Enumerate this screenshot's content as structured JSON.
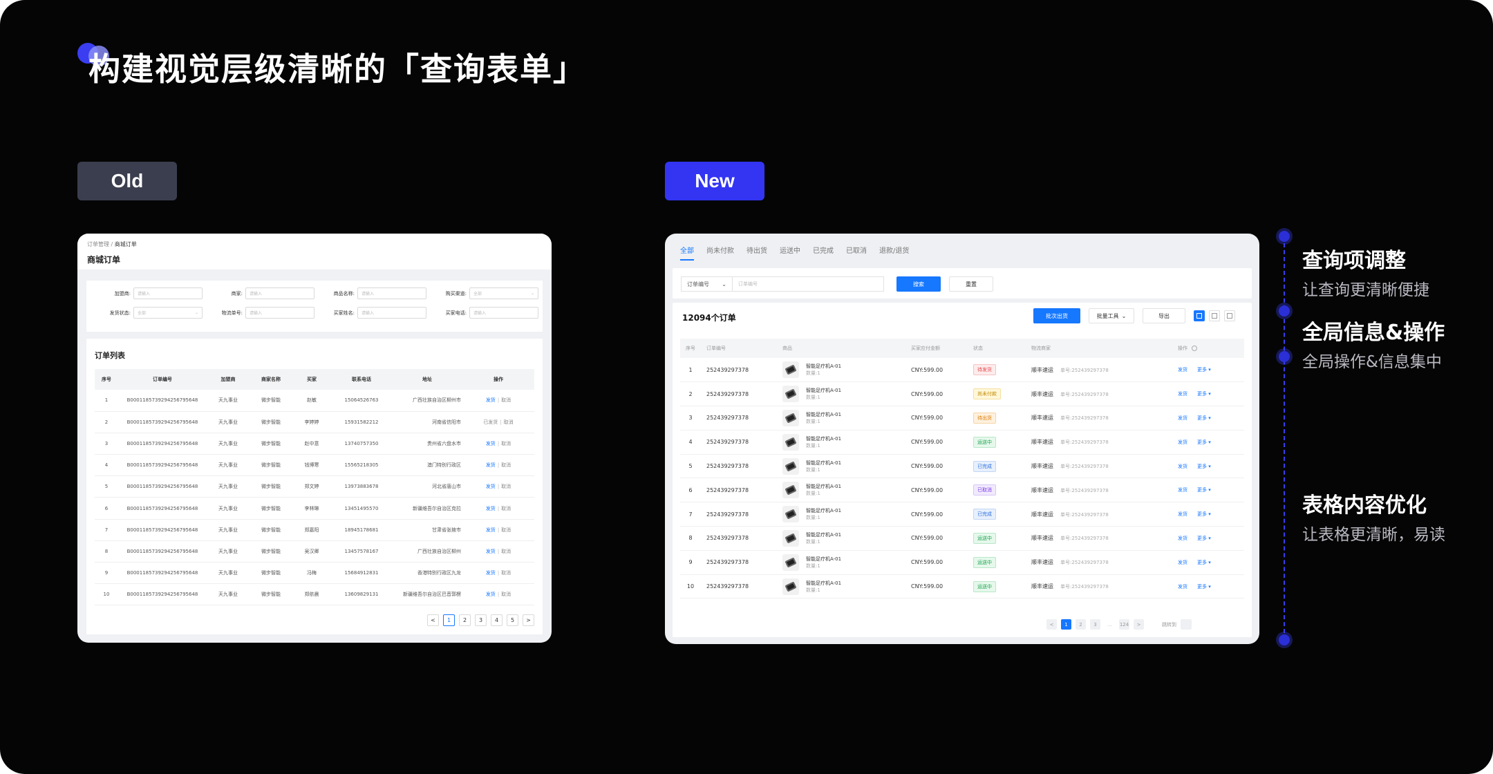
{
  "page": {
    "title": "构建视觉层级清晰的「查询表单」"
  },
  "badges": {
    "old": "Old",
    "new": "New"
  },
  "old": {
    "breadcrumb": {
      "root": "订单管理",
      "sep": "/",
      "current": "商城订单"
    },
    "heading": "商城订单",
    "form": [
      {
        "label": "加盟商:",
        "placeholder": "请输入"
      },
      {
        "label": "商家:",
        "placeholder": "请输入"
      },
      {
        "label": "商品名称:",
        "placeholder": "请输入"
      },
      {
        "label": "购买渠道:",
        "placeholder": "全部"
      },
      {
        "label": "发货状态:",
        "placeholder": "全部"
      },
      {
        "label": "物流单号:",
        "placeholder": "请输入"
      },
      {
        "label": "买家姓名:",
        "placeholder": "请输入"
      },
      {
        "label": "买家电话:",
        "placeholder": "请输入"
      }
    ],
    "list_title": "订单列表",
    "columns": [
      "序号",
      "订单编号",
      "加盟商",
      "商家名称",
      "买家",
      "联系电话",
      "地址",
      "操作"
    ],
    "rows": [
      [
        "1",
        "B0001185739294256795648",
        "天九事业",
        "微步智能",
        "赵敏",
        "15064526763",
        "广西壮族自治区柳州市",
        "发货",
        "取消"
      ],
      [
        "2",
        "B0001185739294256795648",
        "天九事业",
        "微步智能",
        "李婷婷",
        "15931582212",
        "河南省信阳市",
        "已发货",
        "取消"
      ],
      [
        "3",
        "B0001185739294256795648",
        "天九事业",
        "微步智能",
        "赵中意",
        "13740757350",
        "贵州省六盘水市",
        "发货",
        "取消"
      ],
      [
        "4",
        "B0001185739294256795648",
        "天九事业",
        "微步智能",
        "钱博寒",
        "15565218305",
        "澳门特别行政区",
        "发货",
        "取消"
      ],
      [
        "5",
        "B0001185739294256795648",
        "天九事业",
        "微步智能",
        "郑文婷",
        "13973883678",
        "河北省唐山市",
        "发货",
        "取消"
      ],
      [
        "6",
        "B0001185739294256795648",
        "天九事业",
        "微步智能",
        "李林琳",
        "13451495570",
        "新疆维吾尔自治区克拉",
        "发货",
        "取消"
      ],
      [
        "7",
        "B0001185739294256795648",
        "天九事业",
        "微步智能",
        "郑嘉阳",
        "18945178681",
        "甘肃省张掖市",
        "发货",
        "取消"
      ],
      [
        "8",
        "B0001185739294256795648",
        "天九事业",
        "微步智能",
        "吴汉卿",
        "13457578167",
        "广西壮族自治区柳州",
        "发货",
        "取消"
      ],
      [
        "9",
        "B0001185739294256795648",
        "天九事业",
        "微步智能",
        "冯梅",
        "15684912831",
        "香港特别行政区九龙",
        "发货",
        "取消"
      ],
      [
        "10",
        "B0001185739294256795648",
        "天九事业",
        "微步智能",
        "郑依晨",
        "13609829131",
        "新疆维吾尔自治区巴音郭楞",
        "发货",
        "取消"
      ]
    ],
    "pager": {
      "prev": "<",
      "pages": [
        "1",
        "2",
        "3",
        "4",
        "5"
      ],
      "next": ">",
      "current": "1"
    }
  },
  "new": {
    "tabs": [
      "全部",
      "尚未付款",
      "待出货",
      "运送中",
      "已完成",
      "已取消",
      "退款/退货"
    ],
    "active_tab": "全部",
    "search": {
      "select": "订单编号",
      "placeholder": "订单编号",
      "search": "搜索",
      "reset": "重置"
    },
    "count": "12094个订单",
    "toolbar": {
      "batch_ship": "批次出货",
      "batch_tools": "批量工具",
      "export": "导出"
    },
    "columns": [
      "序号",
      "订单编号",
      "商品",
      "买家应付金额",
      "状态",
      "物流商家",
      "操作"
    ],
    "product": {
      "name": "智能足疗机A-01",
      "qty": "数量:1"
    },
    "rows": [
      {
        "idx": "1",
        "order": "252439297378",
        "amount": "CNY:599.00",
        "status": "待发货",
        "tone": "t1",
        "carrier": "顺丰速运",
        "track": "单号:252439297378",
        "ship": "发货",
        "more": "更多 ▾"
      },
      {
        "idx": "2",
        "order": "252439297378",
        "amount": "CNY:599.00",
        "status": "尚未付款",
        "tone": "t2",
        "carrier": "顺丰速运",
        "track": "单号:252439297378",
        "ship": "发货",
        "more": "更多 ▾"
      },
      {
        "idx": "3",
        "order": "252439297378",
        "amount": "CNY:599.00",
        "status": "待出货",
        "tone": "t3",
        "carrier": "顺丰速运",
        "track": "单号:252439297378",
        "ship": "发货",
        "more": "更多 ▾"
      },
      {
        "idx": "4",
        "order": "252439297378",
        "amount": "CNY:599.00",
        "status": "运送中",
        "tone": "t4",
        "carrier": "顺丰速运",
        "track": "单号:252439297378",
        "ship": "发货",
        "more": "更多 ▾"
      },
      {
        "idx": "5",
        "order": "252439297378",
        "amount": "CNY:599.00",
        "status": "已完成",
        "tone": "t5",
        "carrier": "顺丰速运",
        "track": "单号:252439297378",
        "ship": "发货",
        "more": "更多 ▾"
      },
      {
        "idx": "6",
        "order": "252439297378",
        "amount": "CNY:599.00",
        "status": "已取消",
        "tone": "t6",
        "carrier": "顺丰速运",
        "track": "单号:252439297378",
        "ship": "发货",
        "more": "更多 ▾"
      },
      {
        "idx": "7",
        "order": "252439297378",
        "amount": "CNY:599.00",
        "status": "已完成",
        "tone": "t5",
        "carrier": "顺丰速运",
        "track": "单号:252439297378",
        "ship": "发货",
        "more": "更多 ▾"
      },
      {
        "idx": "8",
        "order": "252439297378",
        "amount": "CNY:599.00",
        "status": "运送中",
        "tone": "t4",
        "carrier": "顺丰速运",
        "track": "单号:252439297378",
        "ship": "发货",
        "more": "更多 ▾"
      },
      {
        "idx": "9",
        "order": "252439297378",
        "amount": "CNY:599.00",
        "status": "运送中",
        "tone": "t4",
        "carrier": "顺丰速运",
        "track": "单号:252439297378",
        "ship": "发货",
        "more": "更多 ▾"
      },
      {
        "idx": "10",
        "order": "252439297378",
        "amount": "CNY:599.00",
        "status": "运送中",
        "tone": "t4",
        "carrier": "顺丰速运",
        "track": "单号:252439297378",
        "ship": "发货",
        "more": "更多 ▾"
      }
    ],
    "pager": {
      "prev": "<",
      "pages": [
        "1",
        "2",
        "3"
      ],
      "dots": "...",
      "last": "124",
      "next": ">",
      "current": "1",
      "jump_label": "跳转到",
      "jump_value": ""
    }
  },
  "notes": [
    {
      "title": "查询项调整",
      "desc": "让查询更清晰便捷"
    },
    {
      "title": "全局信息&操作",
      "desc": "全局操作&信息集中"
    },
    {
      "title": "表格内容优化",
      "desc": "让表格更清晰，易读"
    }
  ],
  "colors": {
    "accent": "#3335f2",
    "primary": "#1677ff",
    "background": "#050505"
  }
}
